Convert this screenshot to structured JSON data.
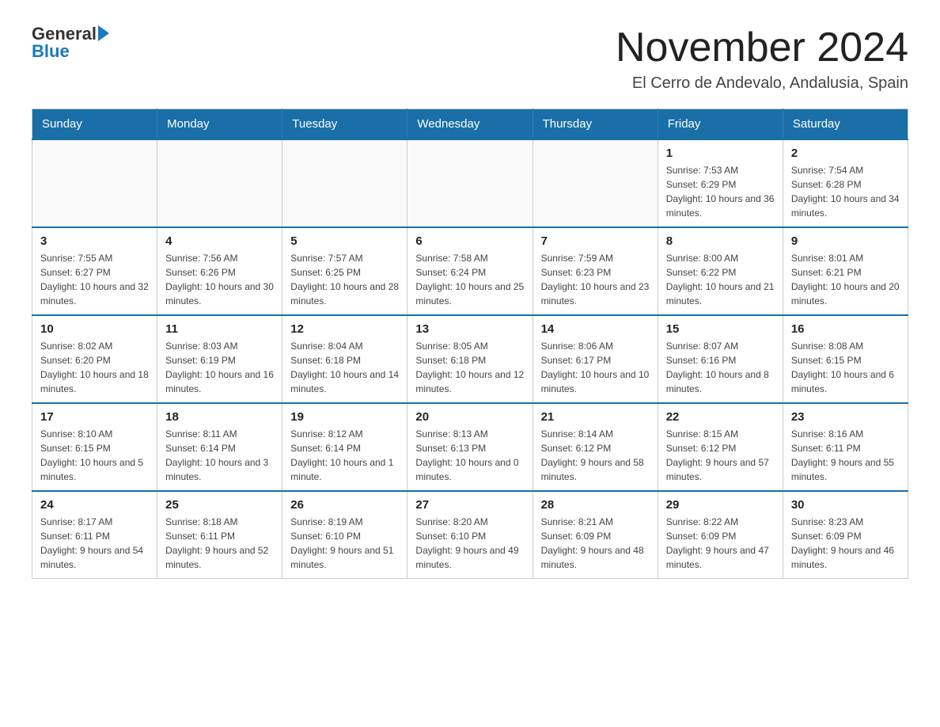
{
  "logo": {
    "text_general": "General",
    "text_blue": "Blue"
  },
  "header": {
    "title": "November 2024",
    "subtitle": "El Cerro de Andevalo, Andalusia, Spain"
  },
  "weekdays": [
    "Sunday",
    "Monday",
    "Tuesday",
    "Wednesday",
    "Thursday",
    "Friday",
    "Saturday"
  ],
  "weeks": [
    [
      {
        "day": "",
        "sunrise": "",
        "sunset": "",
        "daylight": ""
      },
      {
        "day": "",
        "sunrise": "",
        "sunset": "",
        "daylight": ""
      },
      {
        "day": "",
        "sunrise": "",
        "sunset": "",
        "daylight": ""
      },
      {
        "day": "",
        "sunrise": "",
        "sunset": "",
        "daylight": ""
      },
      {
        "day": "",
        "sunrise": "",
        "sunset": "",
        "daylight": ""
      },
      {
        "day": "1",
        "sunrise": "Sunrise: 7:53 AM",
        "sunset": "Sunset: 6:29 PM",
        "daylight": "Daylight: 10 hours and 36 minutes."
      },
      {
        "day": "2",
        "sunrise": "Sunrise: 7:54 AM",
        "sunset": "Sunset: 6:28 PM",
        "daylight": "Daylight: 10 hours and 34 minutes."
      }
    ],
    [
      {
        "day": "3",
        "sunrise": "Sunrise: 7:55 AM",
        "sunset": "Sunset: 6:27 PM",
        "daylight": "Daylight: 10 hours and 32 minutes."
      },
      {
        "day": "4",
        "sunrise": "Sunrise: 7:56 AM",
        "sunset": "Sunset: 6:26 PM",
        "daylight": "Daylight: 10 hours and 30 minutes."
      },
      {
        "day": "5",
        "sunrise": "Sunrise: 7:57 AM",
        "sunset": "Sunset: 6:25 PM",
        "daylight": "Daylight: 10 hours and 28 minutes."
      },
      {
        "day": "6",
        "sunrise": "Sunrise: 7:58 AM",
        "sunset": "Sunset: 6:24 PM",
        "daylight": "Daylight: 10 hours and 25 minutes."
      },
      {
        "day": "7",
        "sunrise": "Sunrise: 7:59 AM",
        "sunset": "Sunset: 6:23 PM",
        "daylight": "Daylight: 10 hours and 23 minutes."
      },
      {
        "day": "8",
        "sunrise": "Sunrise: 8:00 AM",
        "sunset": "Sunset: 6:22 PM",
        "daylight": "Daylight: 10 hours and 21 minutes."
      },
      {
        "day": "9",
        "sunrise": "Sunrise: 8:01 AM",
        "sunset": "Sunset: 6:21 PM",
        "daylight": "Daylight: 10 hours and 20 minutes."
      }
    ],
    [
      {
        "day": "10",
        "sunrise": "Sunrise: 8:02 AM",
        "sunset": "Sunset: 6:20 PM",
        "daylight": "Daylight: 10 hours and 18 minutes."
      },
      {
        "day": "11",
        "sunrise": "Sunrise: 8:03 AM",
        "sunset": "Sunset: 6:19 PM",
        "daylight": "Daylight: 10 hours and 16 minutes."
      },
      {
        "day": "12",
        "sunrise": "Sunrise: 8:04 AM",
        "sunset": "Sunset: 6:18 PM",
        "daylight": "Daylight: 10 hours and 14 minutes."
      },
      {
        "day": "13",
        "sunrise": "Sunrise: 8:05 AM",
        "sunset": "Sunset: 6:18 PM",
        "daylight": "Daylight: 10 hours and 12 minutes."
      },
      {
        "day": "14",
        "sunrise": "Sunrise: 8:06 AM",
        "sunset": "Sunset: 6:17 PM",
        "daylight": "Daylight: 10 hours and 10 minutes."
      },
      {
        "day": "15",
        "sunrise": "Sunrise: 8:07 AM",
        "sunset": "Sunset: 6:16 PM",
        "daylight": "Daylight: 10 hours and 8 minutes."
      },
      {
        "day": "16",
        "sunrise": "Sunrise: 8:08 AM",
        "sunset": "Sunset: 6:15 PM",
        "daylight": "Daylight: 10 hours and 6 minutes."
      }
    ],
    [
      {
        "day": "17",
        "sunrise": "Sunrise: 8:10 AM",
        "sunset": "Sunset: 6:15 PM",
        "daylight": "Daylight: 10 hours and 5 minutes."
      },
      {
        "day": "18",
        "sunrise": "Sunrise: 8:11 AM",
        "sunset": "Sunset: 6:14 PM",
        "daylight": "Daylight: 10 hours and 3 minutes."
      },
      {
        "day": "19",
        "sunrise": "Sunrise: 8:12 AM",
        "sunset": "Sunset: 6:14 PM",
        "daylight": "Daylight: 10 hours and 1 minute."
      },
      {
        "day": "20",
        "sunrise": "Sunrise: 8:13 AM",
        "sunset": "Sunset: 6:13 PM",
        "daylight": "Daylight: 10 hours and 0 minutes."
      },
      {
        "day": "21",
        "sunrise": "Sunrise: 8:14 AM",
        "sunset": "Sunset: 6:12 PM",
        "daylight": "Daylight: 9 hours and 58 minutes."
      },
      {
        "day": "22",
        "sunrise": "Sunrise: 8:15 AM",
        "sunset": "Sunset: 6:12 PM",
        "daylight": "Daylight: 9 hours and 57 minutes."
      },
      {
        "day": "23",
        "sunrise": "Sunrise: 8:16 AM",
        "sunset": "Sunset: 6:11 PM",
        "daylight": "Daylight: 9 hours and 55 minutes."
      }
    ],
    [
      {
        "day": "24",
        "sunrise": "Sunrise: 8:17 AM",
        "sunset": "Sunset: 6:11 PM",
        "daylight": "Daylight: 9 hours and 54 minutes."
      },
      {
        "day": "25",
        "sunrise": "Sunrise: 8:18 AM",
        "sunset": "Sunset: 6:11 PM",
        "daylight": "Daylight: 9 hours and 52 minutes."
      },
      {
        "day": "26",
        "sunrise": "Sunrise: 8:19 AM",
        "sunset": "Sunset: 6:10 PM",
        "daylight": "Daylight: 9 hours and 51 minutes."
      },
      {
        "day": "27",
        "sunrise": "Sunrise: 8:20 AM",
        "sunset": "Sunset: 6:10 PM",
        "daylight": "Daylight: 9 hours and 49 minutes."
      },
      {
        "day": "28",
        "sunrise": "Sunrise: 8:21 AM",
        "sunset": "Sunset: 6:09 PM",
        "daylight": "Daylight: 9 hours and 48 minutes."
      },
      {
        "day": "29",
        "sunrise": "Sunrise: 8:22 AM",
        "sunset": "Sunset: 6:09 PM",
        "daylight": "Daylight: 9 hours and 47 minutes."
      },
      {
        "day": "30",
        "sunrise": "Sunrise: 8:23 AM",
        "sunset": "Sunset: 6:09 PM",
        "daylight": "Daylight: 9 hours and 46 minutes."
      }
    ]
  ]
}
